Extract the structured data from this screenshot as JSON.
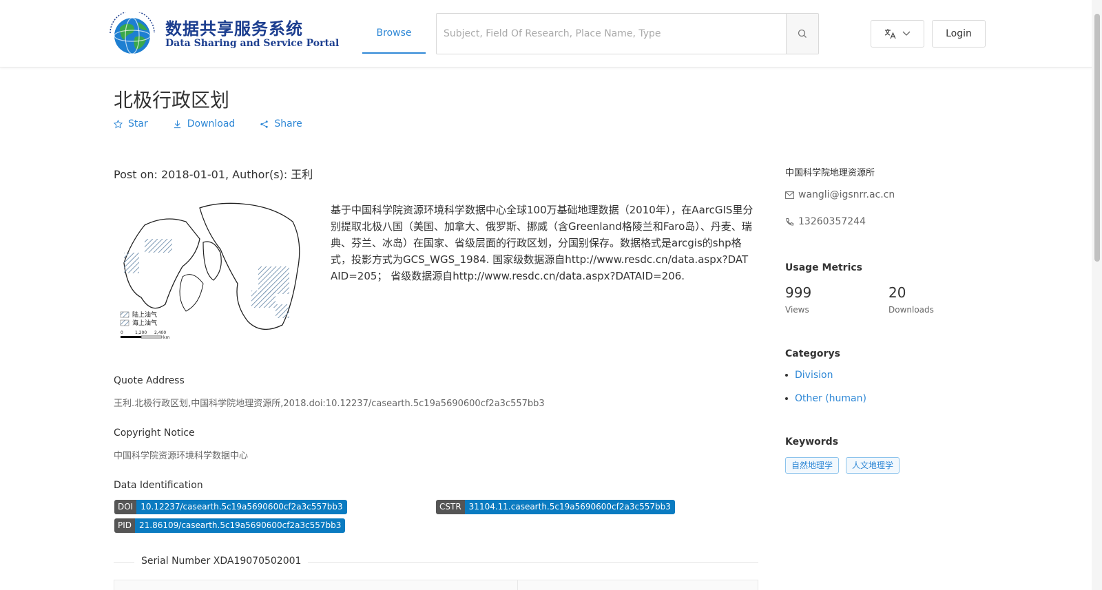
{
  "header": {
    "logo_cn": "数据共享服务系统",
    "logo_en": "Data Sharing and Service Portal",
    "nav_browse": "Browse",
    "search_placeholder": "Subject, Field Of Research, Place Name, Type",
    "login_label": "Login"
  },
  "dataset": {
    "title": "北极行政区划",
    "actions": {
      "star": "Star",
      "download": "Download",
      "share": "Share"
    },
    "post_on": "Post on: 2018-01-01, Author(s): 王利",
    "description": "基于中国科学院资源环境科学数据中心全球100万基础地理数据（2010年），在AarcGIS里分别提取北极八国（美国、加拿大、俄罗斯、挪威（含Greenland格陵兰和Faro岛）、丹麦、瑞典、芬兰、冰岛）在国家、省级层面的行政区划，分国别保存。数据格式是arcgis的shp格式，投影方式为GCS_WGS_1984. 国家级数据源自http://www.resdc.cn/data.aspx?DATAID=205； 省级数据源自http://www.resdc.cn/data.aspx?DATAID=206.",
    "map_legend": [
      "陆上油气",
      "海上油气"
    ],
    "map_scale": [
      "0",
      "1,200",
      "2,400",
      "km"
    ],
    "quote_label": "Quote Address",
    "quote_value": "王利.北极行政区划,中国科学院地理资源所,2018.doi:10.12237/casearth.5c19a5690600cf2a3c557bb3",
    "copyright_label": "Copyright Notice",
    "copyright_value": "中国科学院资源环境科学数据中心",
    "identification_label": "Data Identification",
    "identifiers": [
      {
        "key": "DOI",
        "value": "10.12237/casearth.5c19a5690600cf2a3c557bb3"
      },
      {
        "key": "CSTR",
        "value": "31104.11.casearth.5c19a5690600cf2a3c557bb3"
      },
      {
        "key": "PID",
        "value": "21.86109/casearth.5c19a5690600cf2a3c557bb3"
      }
    ],
    "serial_number": "Serial Number XDA19070502001"
  },
  "sidebar": {
    "organization": "中国科学院地理资源所",
    "email": "wangli@igsnrr.ac.cn",
    "phone": "13260357244",
    "usage_heading": "Usage Metrics",
    "views_value": "999",
    "views_label": "Views",
    "downloads_value": "20",
    "downloads_label": "Downloads",
    "categories_heading": "Categorys",
    "categories": [
      "Division",
      "Other (human)"
    ],
    "keywords_heading": "Keywords",
    "keywords": [
      "自然地理学",
      "人文地理学"
    ]
  }
}
